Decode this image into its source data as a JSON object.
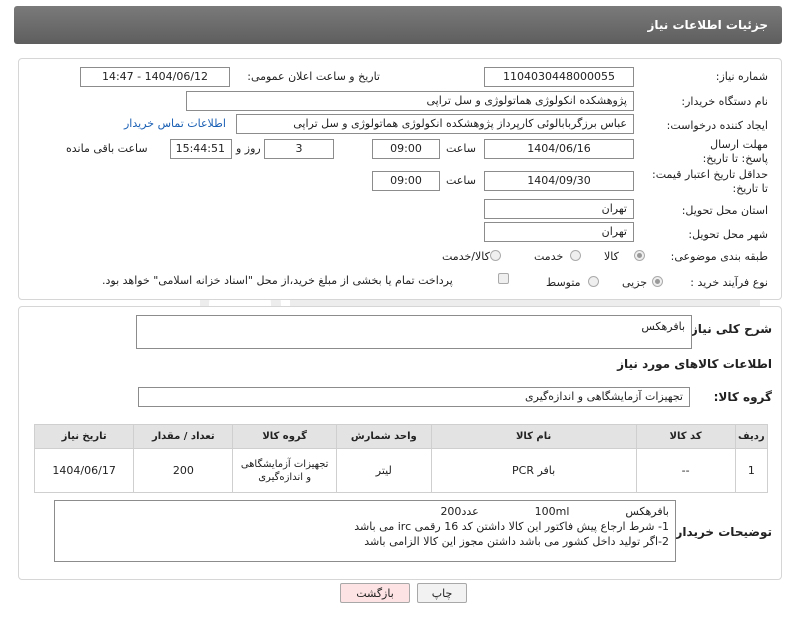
{
  "header": {
    "title": "جزئیات اطلاعات نیاز"
  },
  "form": {
    "need_number_label": "شماره نیاز:",
    "need_number": "1104030448000055",
    "announce_label": "تاریخ و ساعت اعلان عمومی:",
    "announce_value": "1404/06/12 - 14:47",
    "buyer_org_label": "نام دستگاه خریدار:",
    "buyer_org": "پژوهشکده انکولوژی هماتولوژی و سل تراپی",
    "requester_label": "ایجاد کننده درخواست:",
    "requester": "عباس برزگربابالوئی کارپرداز پژوهشکده انکولوژی هماتولوژی و سل تراپی",
    "contact_link": "اطلاعات تماس خریدار",
    "reply_deadline_label": "مهلت ارسال پاسخ: تا تاریخ:",
    "reply_date": "1404/06/16",
    "time_label": "ساعت",
    "reply_time": "09:00",
    "days_value": "3",
    "days_label": "روز و",
    "remaining_time": "15:44:51",
    "remaining_label": "ساعت باقی مانده",
    "price_validity_label": "حداقل تاریخ اعتبار قیمت: تا تاریخ:",
    "price_date": "1404/09/30",
    "price_time_label": "ساعت",
    "price_time": "09:00",
    "delivery_province_label": "استان محل تحویل:",
    "delivery_province": "تهران",
    "delivery_city_label": "شهر محل تحویل:",
    "delivery_city": "تهران",
    "category_label": "طبقه بندی موضوعی:",
    "category_options": [
      "کالا",
      "خدمت",
      "کالا/خدمت"
    ],
    "process_label": "نوع فرآیند خرید :",
    "process_options": [
      "جزیی",
      "متوسط"
    ],
    "payment_note": "پرداخت تمام یا بخشی از مبلغ خرید،از محل \"اسناد خزانه اسلامی\" خواهد بود."
  },
  "summary": {
    "label": "شرح کلی نیاز:",
    "value": "بافرهکس"
  },
  "goods": {
    "section_title": "اطلاعات کالاهای مورد نیاز",
    "group_label": "گروه کالا:",
    "group_value": "تجهیزات آزمایشگاهی و اندازه‌گیری",
    "columns": [
      "ردیف",
      "کد کالا",
      "نام کالا",
      "واحد شمارش",
      "گروه کالا",
      "تعداد / مقدار",
      "تاریخ نیاز"
    ],
    "rows": [
      {
        "row": "1",
        "code": "--",
        "name": "بافر PCR",
        "unit": "لیتر",
        "group": "تجهیزات آزمایشگاهی و اندازه‌گیری",
        "qty": "200",
        "date": "1404/06/17"
      }
    ]
  },
  "buyer_notes": {
    "label": "توضیحات خریدار:",
    "line1": "بافرهکس                100ml                عدد200",
    "line2": "1- شرط ارجاع پیش فاکتور این کالا داشتن کد 16 رقمی  irc می باشد",
    "line3": "2-اگر تولید داخل  کشور می باشد داشتن مجوز این کالا الزامی باشد"
  },
  "buttons": {
    "print": "چاپ",
    "back": "بازگشت"
  },
  "colors": {
    "titlebar": "#6b6b6b",
    "link": "#1a5fb4",
    "back_button": "#fde3e3"
  }
}
